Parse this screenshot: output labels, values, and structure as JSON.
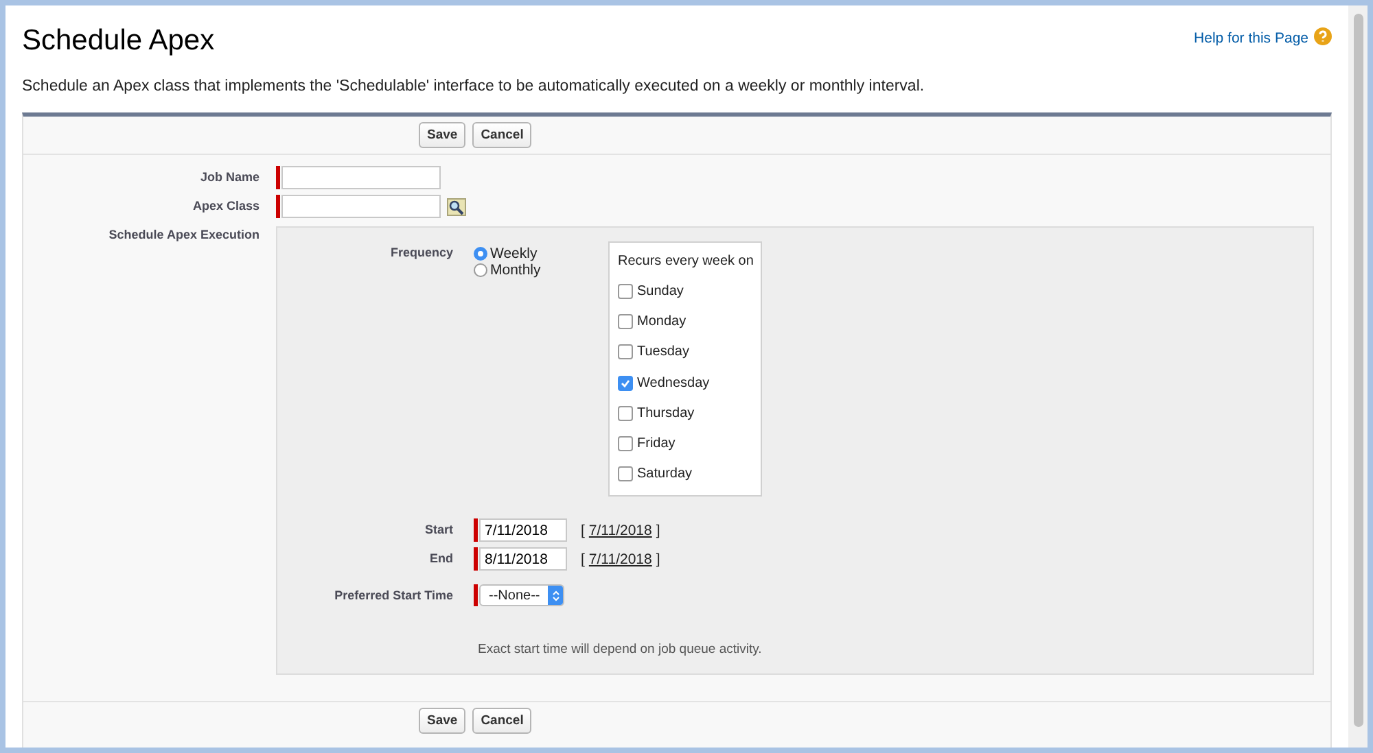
{
  "header": {
    "title": "Schedule Apex",
    "help_link": "Help for this Page"
  },
  "description": "Schedule an Apex class that implements the 'Schedulable' interface to be automatically executed on a weekly or monthly interval.",
  "top_buttons": [
    "Save",
    "Cancel"
  ],
  "fields": [
    {
      "label": "Job Name",
      "kind": "text"
    },
    {
      "label": "Apex Class",
      "kind": "lookup"
    }
  ],
  "schedule": {
    "label": "Schedule Apex Execution",
    "frequency": {
      "label": "Frequency",
      "options": [
        {
          "label": "Weekly",
          "selected": true
        },
        {
          "label": "Monthly",
          "selected": false
        }
      ]
    },
    "recurs": {
      "title": "Recurs every week on",
      "days": [
        {
          "label": "Sunday",
          "checked": false
        },
        {
          "label": "Monday",
          "checked": false
        },
        {
          "label": "Tuesday",
          "checked": false
        },
        {
          "label": "Wednesday",
          "checked": true
        },
        {
          "label": "Thursday",
          "checked": false
        },
        {
          "label": "Friday",
          "checked": false
        },
        {
          "label": "Saturday",
          "checked": false
        }
      ]
    },
    "dates": [
      {
        "label": "Start",
        "value": "7/11/2018",
        "open": "[",
        "today_link": "7/11/2018",
        "close": "]"
      },
      {
        "label": "End",
        "value": "8/11/2018",
        "open": "[",
        "today_link": "7/11/2018",
        "close": "]"
      }
    ],
    "preferred_start_time": {
      "label": "Preferred Start Time",
      "value": "--None--"
    },
    "note": "Exact start time will depend on job queue activity."
  },
  "bottom_buttons": [
    "Save",
    "Cancel"
  ]
}
